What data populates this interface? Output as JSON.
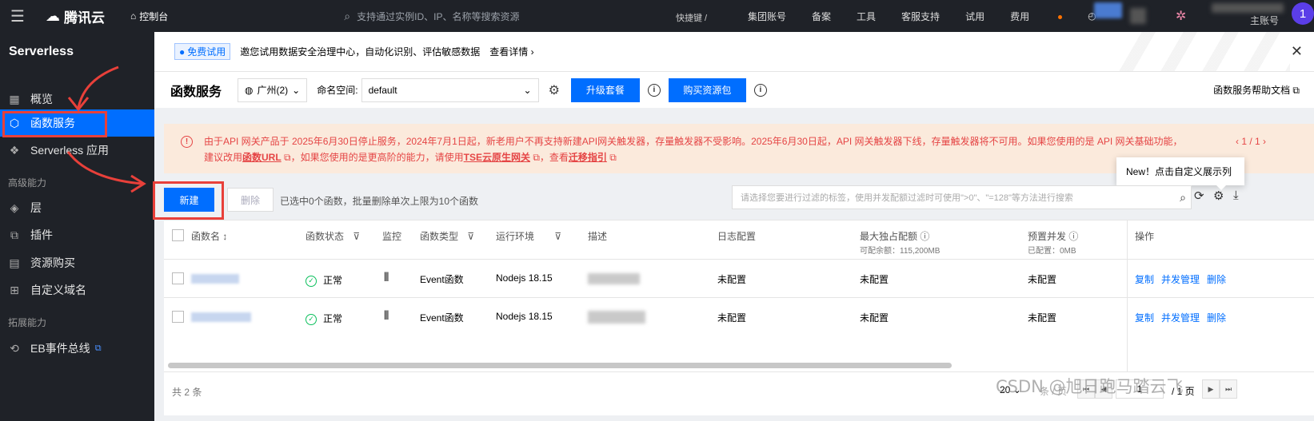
{
  "topbar": {
    "logo": "腾讯云",
    "console": "控制台",
    "search_placeholder": "支持通过实例ID、IP、名称等搜索资源",
    "shortcut": "快捷键 /",
    "menu": [
      "集团账号",
      "备案",
      "工具",
      "客服支持",
      "试用",
      "费用"
    ],
    "user_role": "主账号",
    "avatar_initial": "1"
  },
  "sidebar": {
    "title": "Serverless",
    "items": [
      {
        "label": "概览",
        "icon": "grid-icon"
      },
      {
        "label": "函数服务",
        "icon": "function-icon"
      },
      {
        "label": "Serverless 应用",
        "icon": "app-icon"
      }
    ],
    "section_advanced": "高级能力",
    "advanced_items": [
      {
        "label": "层",
        "icon": "layers-icon"
      },
      {
        "label": "插件",
        "icon": "plugin-icon"
      },
      {
        "label": "资源购买",
        "icon": "purchase-icon"
      },
      {
        "label": "自定义域名",
        "icon": "domain-icon"
      }
    ],
    "section_ext": "拓展能力",
    "ext_items": [
      {
        "label": "EB事件总线",
        "icon": "event-bus-icon"
      }
    ]
  },
  "notice": {
    "badge": "免费试用",
    "text": "邀您试用数据安全治理中心，自动化识别、评估敏感数据",
    "link": "查看详情 ›"
  },
  "header": {
    "title": "函数服务",
    "region": "广州(2)",
    "namespace_label": "命名空间:",
    "namespace_value": "default",
    "upgrade_btn": "升级套餐",
    "buy_btn": "购买资源包",
    "help_doc": "函数服务帮助文档"
  },
  "warning": {
    "line1": "由于API 网关产品于 2025年6月30日停止服务，2024年7月1日起，新老用户不再支持新建API网关触发器，存量触发器不受影响。2025年6月30日起，API 网关触发器下线，存量触发器将不可用。如果您使用的是 API 网关基础功能，建议改用",
    "link1": "函数URL",
    "mid": "，如果您使用的是更高阶的能力，请使用",
    "link2": "TSE云原生网关",
    "mid2": "，查看",
    "link3": "迁移指引",
    "page": "‹ 1 / 1 ›"
  },
  "tooltip": "New！点击自定义展示列",
  "toolbar": {
    "new_btn": "新建",
    "delete_btn": "删除",
    "selection_info": "已选中0个函数，批量删除单次上限为10个函数",
    "search_placeholder": "请选择您要进行过滤的标签，使用并发配额过滤时可使用\">0\"、\"=128\"等方法进行搜索"
  },
  "table": {
    "headers": {
      "name": "函数名",
      "status": "函数状态",
      "monitor": "监控",
      "type": "函数类型",
      "runtime": "运行环境",
      "desc": "描述",
      "log": "日志配置",
      "max_quota": "最大独占配额",
      "max_quota_sub": "可配余额：115,200MB",
      "prealloc": "预置并发",
      "prealloc_sub": "已配置：0MB",
      "ops": "操作"
    },
    "rows": [
      {
        "status": "正常",
        "type": "Event函数",
        "runtime": "Nodejs 18.15",
        "log": "未配置",
        "max_quota": "未配置",
        "prealloc": "未配置"
      },
      {
        "status": "正常",
        "type": "Event函数",
        "runtime": "Nodejs 18.15",
        "log": "未配置",
        "max_quota": "未配置",
        "prealloc": "未配置"
      }
    ],
    "ops": [
      "复制",
      "并发管理",
      "删除"
    ]
  },
  "footer": {
    "total": "共 2 条",
    "page_size": "20",
    "page_unit": "条 / 页",
    "page_input": "1",
    "page_total": "/ 1 页"
  },
  "watermark": "CSDN @旭日跑马踏云飞",
  "colors": {
    "accent": "#006eff",
    "sidebar_bg": "#1f2228",
    "warn_bg": "#fbeadc",
    "warn_text": "#e54545",
    "annotation": "#e8403a"
  }
}
